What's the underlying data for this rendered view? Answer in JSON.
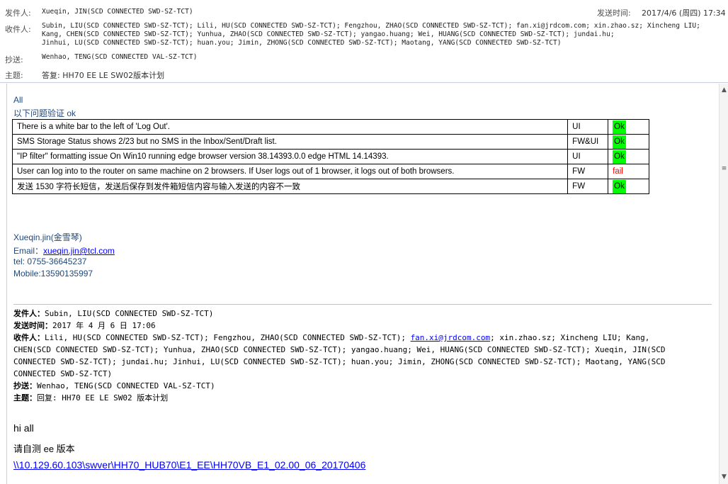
{
  "header": {
    "from_label": "发件人:",
    "from_value": "Xueqin, JIN(SCD CONNECTED SWD-SZ-TCT)",
    "sent_label": "发送时间:",
    "sent_value": "2017/4/6 (周四) 17:34",
    "to_label": "收件人:",
    "to_line1": "Subin, LIU(SCD CONNECTED SWD-SZ-TCT); Lili, HU(SCD CONNECTED SWD-SZ-TCT); Fengzhou, ZHAO(SCD CONNECTED SWD-SZ-TCT); fan.xi@jrdcom.com; xin.zhao.sz; Xincheng LIU;",
    "to_line2": "Kang, CHEN(SCD CONNECTED SWD-SZ-TCT); Yunhua, ZHAO(SCD CONNECTED SWD-SZ-TCT); yangao.huang; Wei, HUANG(SCD CONNECTED SWD-SZ-TCT); jundai.hu;",
    "to_line3": "Jinhui, LU(SCD CONNECTED SWD-SZ-TCT); huan.you; Jimin, ZHONG(SCD CONNECTED SWD-SZ-TCT); Maotang, YANG(SCD CONNECTED SWD-SZ-TCT)",
    "cc_label": "抄送:",
    "cc_value": "Wenhao, TENG(SCD CONNECTED VAL-SZ-TCT)",
    "subject_label": "主题:",
    "subject_value": "答复: HH70 EE LE SW02版本计划"
  },
  "body": {
    "greeting": "All",
    "intro": "以下问题验证 ok",
    "issues": [
      {
        "desc": "There is a white bar to the left of 'Log Out'.",
        "owner": "UI",
        "status": "Ok"
      },
      {
        "desc": "SMS Storage Status shows 2/23 but no SMS in the Inbox/Sent/Draft list.",
        "owner": "FW&UI",
        "status": "Ok"
      },
      {
        "desc": "\"IP filter\" formatting issue On Win10 running edge browser version 38.14393.0.0 edge HTML 14.14393.",
        "owner": "UI",
        "status": "Ok"
      },
      {
        "desc": "User can log into to the router on same machine on 2 browsers. If User logs out of 1 browser, it logs out of both browsers.",
        "owner": "FW",
        "status": "fail"
      },
      {
        "desc": "发送 1530 字符长短信，发送后保存到发件箱短信内容与输入发送的内容不一致",
        "owner": "FW",
        "status": "Ok"
      }
    ],
    "signature": {
      "name": "Xueqin.jin(金雪琴)",
      "email_label": "Email：",
      "email": "xueqin.jin@tcl.com",
      "tel": "tel:  0755-36645237",
      "mobile": "Mobile:13590135997"
    },
    "quoted": {
      "from_label": "发件人：",
      "from_value": "Subin, LIU(SCD CONNECTED SWD-SZ-TCT)",
      "sent_label": "发送时间：",
      "sent_value": "2017 年 4 月 6 日 17:06",
      "to_label": "收件人：",
      "to_a": "Lili, HU(SCD CONNECTED SWD-SZ-TCT); Fengzhou, ZHAO(SCD CONNECTED SWD-SZ-TCT); ",
      "to_link": "fan.xi@jrdcom.com",
      "to_b": "; xin.zhao.sz; Xincheng LIU; Kang,",
      "to_line2": "CHEN(SCD CONNECTED SWD-SZ-TCT); Yunhua, ZHAO(SCD CONNECTED SWD-SZ-TCT); yangao.huang; Wei, HUANG(SCD CONNECTED SWD-SZ-TCT); Xueqin, JIN(SCD",
      "to_line3": "CONNECTED SWD-SZ-TCT); jundai.hu; Jinhui, LU(SCD CONNECTED SWD-SZ-TCT); huan.you; Jimin, ZHONG(SCD CONNECTED SWD-SZ-TCT); Maotang, YANG(SCD",
      "to_line4": "CONNECTED SWD-SZ-TCT)",
      "cc_label": "抄送：",
      "cc_value": "Wenhao, TENG(SCD CONNECTED VAL-SZ-TCT)",
      "subject_label": "主题：",
      "subject_value": "回复: HH70 EE LE SW02 版本计划"
    },
    "tail": {
      "hi": "hi all",
      "self_test": "请自测 ee 版本",
      "path": "\\\\10.129.60.103\\swver\\HH70_HUB70\\E1_EE\\HH70VB_E1_02.00_06_20170406"
    }
  }
}
